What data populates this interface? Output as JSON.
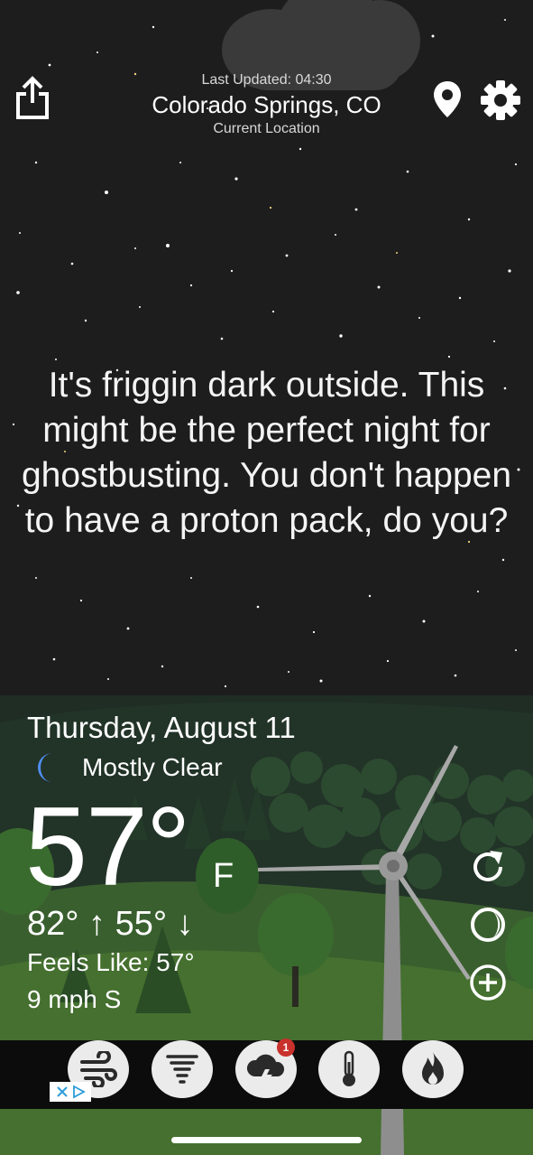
{
  "header": {
    "last_updated": "Last Updated: 04:30",
    "city": "Colorado Springs, CO",
    "location_label": "Current Location"
  },
  "message": "It's friggin dark outside. This might be the perfect night for ghostbusting. You don't happen to have a proton pack, do you?",
  "weather": {
    "date": "Thursday, August 11",
    "condition": "Mostly Clear",
    "condition_icon": "moon-icon",
    "temperature": "57°",
    "unit": "F",
    "high": "82°",
    "low": "55°",
    "feels_like": "Feels Like: 57°",
    "wind": "9 mph S"
  },
  "side_actions": [
    "refresh-icon",
    "moon-phase-icon",
    "add-icon"
  ],
  "dock": {
    "items": [
      "wind-icon",
      "tornado-icon",
      "storm-alert-icon",
      "thermometer-icon",
      "fire-icon"
    ],
    "alert_badge": "1"
  },
  "colors": {
    "sky": "#1d1d1e",
    "hill_dark": "#1f2d24",
    "hill_light": "#3f6b33",
    "moon": "#4f8ff2",
    "badge": "#c9312c",
    "ad_blue": "#2c9cdb"
  }
}
